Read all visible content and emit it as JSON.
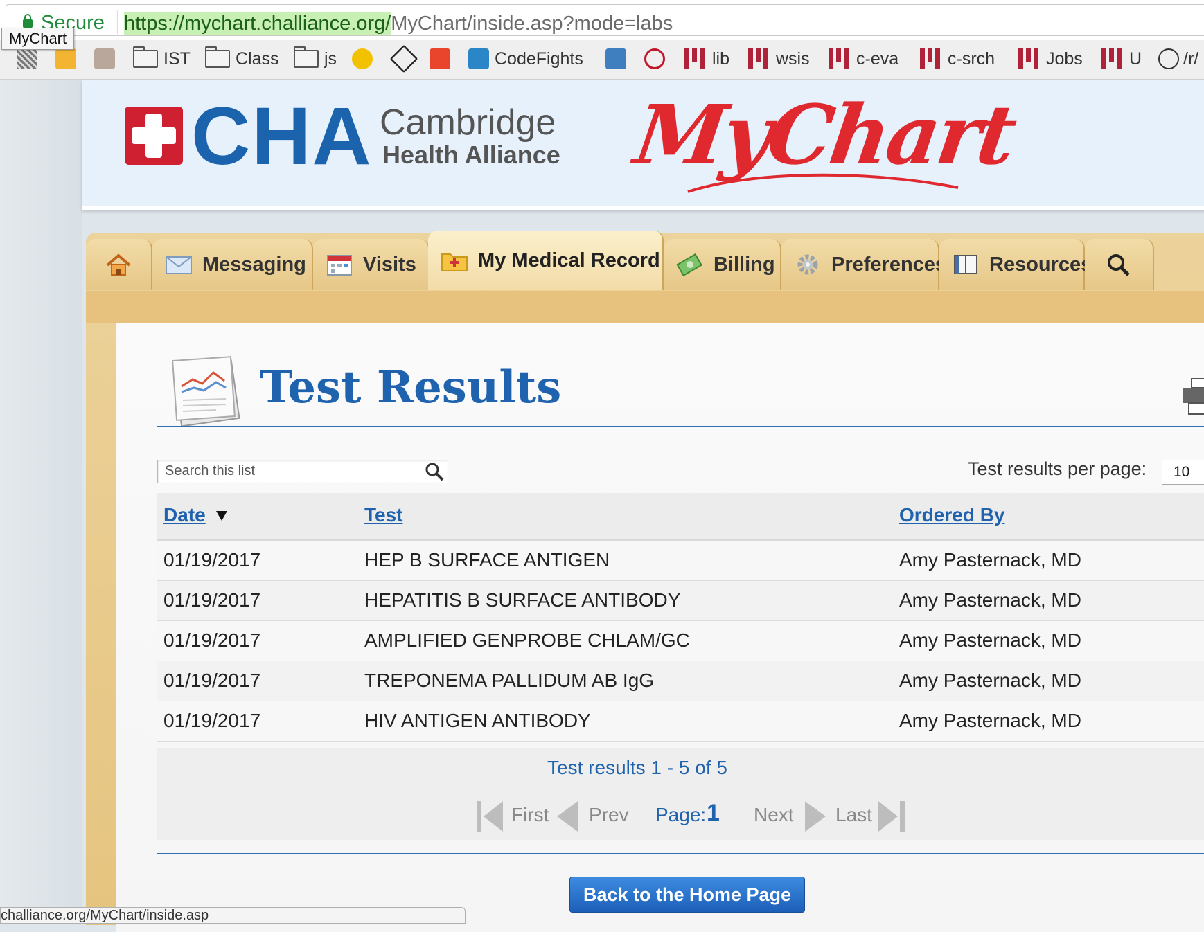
{
  "browser": {
    "secure_label": "Secure",
    "url_highlight": "https://mychart.challiance.org/",
    "url_rest": "MyChart/inside.asp?mode=labs",
    "tooltip": "MyChart",
    "status_url": "challiance.org/MyChart/inside.asp"
  },
  "bookmarks": {
    "ist": "IST",
    "class": "Class",
    "js": "js",
    "codefights": "CodeFights",
    "lib": "lib",
    "wsis": "wsis",
    "ceva": "c-eva",
    "csrch": "c-srch",
    "jobs": "Jobs",
    "u": "U",
    "reddit": "/r/"
  },
  "header": {
    "cha": "CHA",
    "cambridge": "Cambridge",
    "health_alliance": "Health Alliance",
    "mychart": "MyChart"
  },
  "tabs": {
    "messaging": "Messaging",
    "visits": "Visits",
    "medical_record": "My Medical Record",
    "billing": "Billing",
    "preferences": "Preferences",
    "resources": "Resources"
  },
  "page": {
    "title": "Test Results",
    "search_placeholder": "Search this list",
    "perpage_label": "Test results per page:",
    "perpage_value": "10",
    "back_home": "Back to the Home Page"
  },
  "table": {
    "headers": {
      "date": "Date",
      "test": "Test",
      "ordered_by": "Ordered By"
    },
    "rows": [
      {
        "date": "01/19/2017",
        "test": "HEP B SURFACE ANTIGEN",
        "ordered_by": "Amy Pasternack, MD"
      },
      {
        "date": "01/19/2017",
        "test": "HEPATITIS B SURFACE ANTIBODY",
        "ordered_by": "Amy Pasternack, MD"
      },
      {
        "date": "01/19/2017",
        "test": "AMPLIFIED GENPROBE CHLAM/GC",
        "ordered_by": "Amy Pasternack, MD"
      },
      {
        "date": "01/19/2017",
        "test": "TREPONEMA PALLIDUM AB IgG",
        "ordered_by": "Amy Pasternack, MD"
      },
      {
        "date": "01/19/2017",
        "test": "HIV ANTIGEN ANTIBODY",
        "ordered_by": "Amy Pasternack, MD"
      }
    ],
    "count": "Test results 1 - 5 of 5"
  },
  "pager": {
    "first": "First",
    "prev": "Prev",
    "page_label": "Page:",
    "page_num": "1",
    "next": "Next",
    "last": "Last"
  },
  "colors": {
    "brand_blue": "#1f62ad",
    "brand_red": "#cf2031",
    "tab_tan": "#e8c98a"
  }
}
